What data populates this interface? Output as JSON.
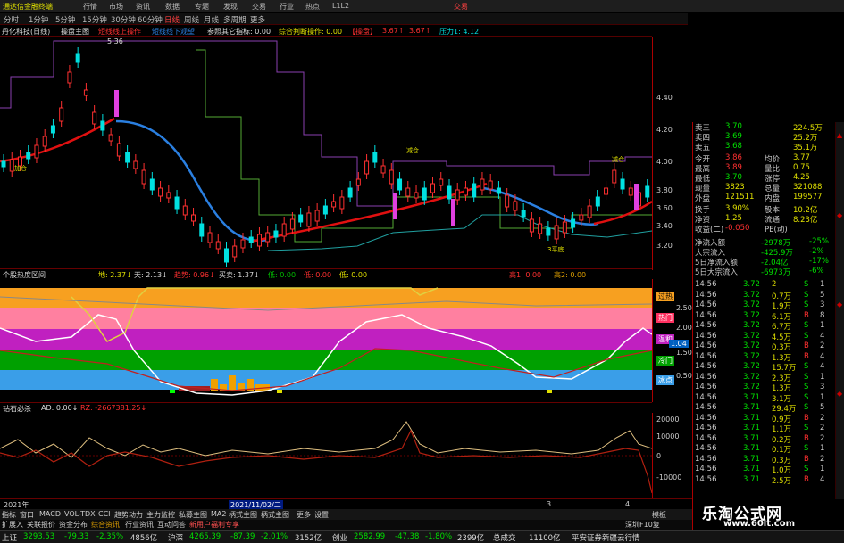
{
  "titlebar": {
    "app": "通达信金融终端",
    "menus": [
      "行情",
      "市场",
      "资讯",
      "数据",
      "专题",
      "发现",
      "交易",
      "行业",
      "热点",
      "L1L2"
    ],
    "right": "交易"
  },
  "periods": {
    "items": [
      "分时",
      "1分钟",
      "5分钟",
      "15分钟",
      "30分钟",
      "60分钟",
      "日线",
      "周线",
      "月线",
      "多周期",
      "更多"
    ],
    "selected": "日线"
  },
  "main_header": {
    "stock": "丹化科技(日线)",
    "indicator": "操盘主图",
    "a": "短线线上操作",
    "b": "短线线下观望",
    "c": "参照其它指标: 0.00",
    "d": "综合判断操作: 0.00",
    "e": "【操盘】",
    "f": "3.67↑",
    "g": "3.67↑",
    "h": "压力1: 4.12"
  },
  "price_axis": [
    "4.40",
    "4.20",
    "4.00",
    "3.80",
    "3.60",
    "3.40",
    "3.20"
  ],
  "chart_labels": {
    "high": "5.36",
    "low": "2.??",
    "buy": "加仓",
    "hold": "减仓",
    "hold2": "持仓",
    "low_label": "3平底"
  },
  "heat_header": {
    "title": "个股热度区间",
    "a": "地: 2.37↓",
    "b": "天: 2.13↓",
    "c": "趋势: 0.96↓",
    "d": "买卖: 1.37↓",
    "e": "低: 0.00",
    "f": "低: 0.00",
    "g": "低: 0.00",
    "h": "高1: 0.00",
    "i": "高2: 0.00"
  },
  "heat_axis": [
    "2.50",
    "2.00",
    "1.50",
    "1.04",
    "0.50"
  ],
  "heat_tags": [
    "过热",
    "热门",
    "温和",
    "冷门",
    "冰点"
  ],
  "ind_header": {
    "title": "钻石必杀",
    "a": "AD: 0.00↓",
    "b": "RZ: -2667381.25↓"
  },
  "ind_axis": [
    "20000",
    "10000",
    "0",
    "-10000"
  ],
  "dateaxis": {
    "a": "2021年",
    "b": "2021/11/02/二",
    "c": "3",
    "d": "4"
  },
  "tabs": [
    "指标",
    "窗口",
    "MACD",
    "VOL-TDX",
    "CCI",
    "趋势动力",
    "主力监控",
    "私募主图",
    "MA2",
    "柄式主图",
    "柄式主图",
    "更多",
    "设置"
  ],
  "tabs_right": "模板",
  "status": {
    "a": "扩展入",
    "b": "关联报价",
    "c": "资金分布",
    "d": "综合资讯",
    "e": "行业资讯",
    "f": "互动问答",
    "g": "新用户福利专享",
    "h": "深圳F10复"
  },
  "index_bar": {
    "sh_label": "上证",
    "sh": "3293.53",
    "sh_chg": "-79.33",
    "sh_pct": "-2.35%",
    "sh_amt": "4856亿",
    "sz_label": "沪深",
    "sz": "4265.39",
    "sz_chg": "-87.39",
    "sz_pct": "-2.01%",
    "sz_amt": "3152亿",
    "cy_label": "创业",
    "cy": "2582.99",
    "cy_chg": "-47.38",
    "cy_pct": "-1.80%",
    "cy_amt": "2399亿",
    "tot": "总成交",
    "tot_val": "11100亿",
    "news": "平安证券新疆云行情"
  },
  "quote_panel": [
    {
      "l": "卖三",
      "v": "3.70",
      "l2": "",
      "v2": "224.5万"
    },
    {
      "l": "卖四",
      "v": "3.69",
      "l2": "",
      "v2": "25.2万"
    },
    {
      "l": "卖五",
      "v": "3.68",
      "l2": "",
      "v2": "35.1万"
    },
    {
      "l": "今开",
      "v": "3.86",
      "l2": "均价",
      "v2": "3.77"
    },
    {
      "l": "最高",
      "v": "3.89",
      "l2": "量比",
      "v2": "0.75"
    },
    {
      "l": "最低",
      "v": "3.70",
      "l2": "涨停",
      "v2": "4.25"
    },
    {
      "l": "现量",
      "v": "3823",
      "l2": "总量",
      "v2": "321088"
    },
    {
      "l": "外盘",
      "v": "121511",
      "l2": "内盘",
      "v2": "199577"
    },
    {
      "l": "换手",
      "v": "3.90%",
      "l2": "股本",
      "v2": "10.2亿"
    },
    {
      "l": "净资",
      "v": "1.25",
      "l2": "流通",
      "v2": "8.23亿"
    },
    {
      "l": "收益(二)",
      "v": "-0.050",
      "l2": "PE(动)",
      "v2": ""
    }
  ],
  "flow_panel": [
    {
      "l": "净流入额",
      "v": "-2978万",
      "p": "-25%"
    },
    {
      "l": "大宗流入",
      "v": "-425.9万",
      "p": "-2%"
    },
    {
      "l": "5日净流入额",
      "v": "-2.04亿",
      "p": "-17%"
    },
    {
      "l": "5日大宗流入",
      "v": "-6973万",
      "p": "-6%"
    }
  ],
  "ticks": [
    {
      "t": "14:56",
      "p": "3.72",
      "v": "2",
      "s": "S",
      "n": "1"
    },
    {
      "t": "14:56",
      "p": "3.72",
      "v": "0.7万",
      "s": "S",
      "n": "5"
    },
    {
      "t": "14:56",
      "p": "3.72",
      "v": "1.9万",
      "s": "S",
      "n": "3"
    },
    {
      "t": "14:56",
      "p": "3.72",
      "v": "6.1万",
      "s": "B",
      "n": "8"
    },
    {
      "t": "14:56",
      "p": "3.72",
      "v": "6.7万",
      "s": "S",
      "n": "1"
    },
    {
      "t": "14:56",
      "p": "3.72",
      "v": "4.5万",
      "s": "S",
      "n": "4"
    },
    {
      "t": "14:56",
      "p": "3.72",
      "v": "0.3万",
      "s": "B",
      "n": "2"
    },
    {
      "t": "14:56",
      "p": "3.72",
      "v": "1.3万",
      "s": "B",
      "n": "4"
    },
    {
      "t": "14:56",
      "p": "3.72",
      "v": "15.7万",
      "s": "S",
      "n": "4"
    },
    {
      "t": "14:56",
      "p": "3.72",
      "v": "2.3万",
      "s": "S",
      "n": "1"
    },
    {
      "t": "14:56",
      "p": "3.72",
      "v": "1.3万",
      "s": "S",
      "n": "3"
    },
    {
      "t": "14:56",
      "p": "3.71",
      "v": "3.1万",
      "s": "S",
      "n": "1"
    },
    {
      "t": "14:56",
      "p": "3.71",
      "v": "29.4万",
      "s": "S",
      "n": "5"
    },
    {
      "t": "14:56",
      "p": "3.71",
      "v": "0.9万",
      "s": "B",
      "n": "2"
    },
    {
      "t": "14:56",
      "p": "3.71",
      "v": "1.1万",
      "s": "S",
      "n": "2"
    },
    {
      "t": "14:56",
      "p": "3.71",
      "v": "0.2万",
      "s": "B",
      "n": "2"
    },
    {
      "t": "14:56",
      "p": "3.71",
      "v": "0.1万",
      "s": "S",
      "n": "1"
    },
    {
      "t": "14:56",
      "p": "3.71",
      "v": "0.3万",
      "s": "B",
      "n": "2"
    },
    {
      "t": "14:56",
      "p": "3.71",
      "v": "1.0万",
      "s": "S",
      "n": "1"
    },
    {
      "t": "14:56",
      "p": "3.71",
      "v": "2.5万",
      "s": "B",
      "n": "4"
    }
  ],
  "banner": {
    "cn": "乐淘公式网",
    "url": "www.60lt.com"
  },
  "colors": {
    "up": "#ff3030",
    "down": "#00e0e0",
    "ma_red": "#e01010",
    "ma_blue": "#2a7fe0"
  }
}
